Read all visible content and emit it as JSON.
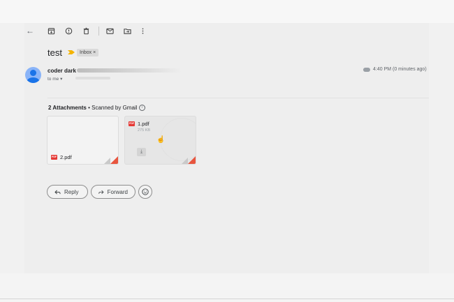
{
  "toolbar": {
    "back_icon": "arrow-left-icon",
    "icons": [
      "archive-icon",
      "report-spam-icon",
      "delete-icon",
      "mark-unread-icon",
      "move-to-icon",
      "more-vert-icon"
    ]
  },
  "email": {
    "subject": "test",
    "label": "Inbox",
    "label_close": "×",
    "sender_name": "coder dark",
    "to_line": "to me",
    "time": "4:40 PM (0 minutes ago)"
  },
  "attachments": {
    "count_label": "2 Attachments",
    "separator": "•",
    "scanned_label": "Scanned by Gmail",
    "info_glyph": "i",
    "files": [
      {
        "name": "2.pdf",
        "badge": "PDF"
      },
      {
        "name": "1.pdf",
        "size": "275 KB",
        "badge": "PDF"
      }
    ]
  },
  "actions": {
    "reply": "Reply",
    "forward": "Forward"
  },
  "colors": {
    "accent": "#1a73e8",
    "pdf_red": "#e53935",
    "importance": "#f4b400"
  }
}
